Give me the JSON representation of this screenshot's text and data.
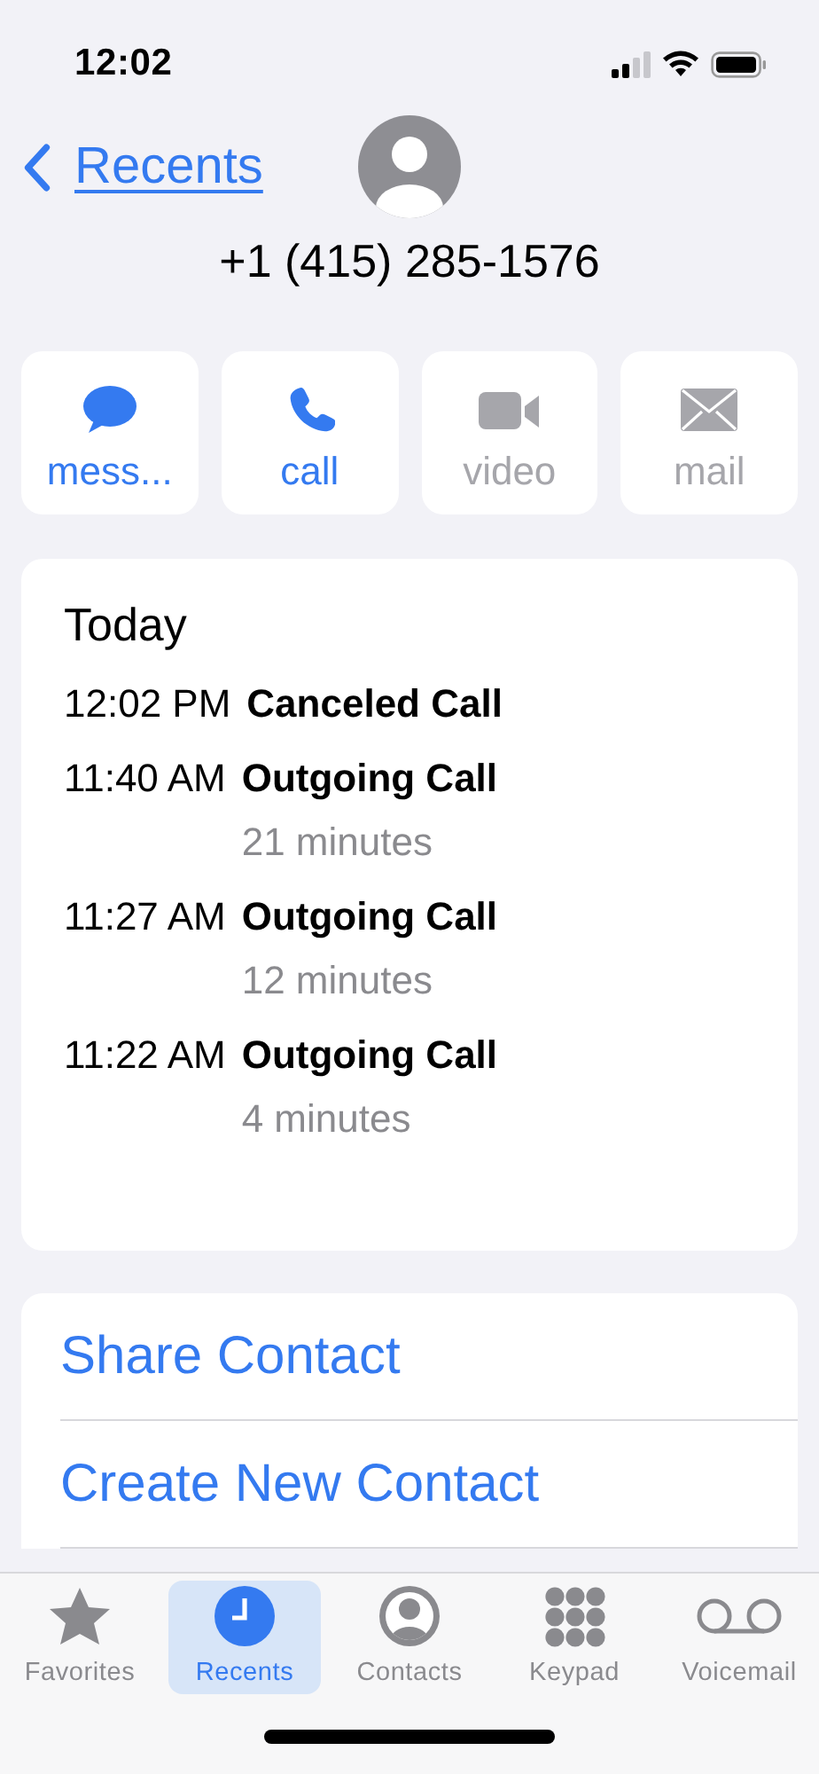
{
  "status_bar": {
    "time": "12:02"
  },
  "nav": {
    "back_label": "Recents"
  },
  "contact": {
    "phone": "+1 (415) 285-1576"
  },
  "actions": [
    {
      "label": "mess...",
      "kind": "message",
      "disabled": false
    },
    {
      "label": "call",
      "kind": "call",
      "disabled": false
    },
    {
      "label": "video",
      "kind": "video",
      "disabled": true
    },
    {
      "label": "mail",
      "kind": "mail",
      "disabled": true
    }
  ],
  "recents": {
    "heading": "Today",
    "calls": [
      {
        "time": "12:02 PM",
        "type": "Canceled Call"
      },
      {
        "time": "11:40 AM",
        "type": "Outgoing Call",
        "duration": "21 minutes"
      },
      {
        "time": "11:27 AM",
        "type": "Outgoing Call",
        "duration": "12 minutes"
      },
      {
        "time": "11:22 AM",
        "type": "Outgoing Call",
        "duration": "4 minutes"
      }
    ]
  },
  "options": [
    {
      "label": "Share Contact"
    },
    {
      "label": "Create New Contact"
    }
  ],
  "tab_bar": [
    {
      "label": "Favorites",
      "kind": "favorites",
      "selected": false
    },
    {
      "label": "Recents",
      "kind": "recents",
      "selected": true
    },
    {
      "label": "Contacts",
      "kind": "contacts",
      "selected": false
    },
    {
      "label": "Keypad",
      "kind": "keypad",
      "selected": false
    },
    {
      "label": "Voicemail",
      "kind": "voicemail",
      "selected": false
    }
  ]
}
